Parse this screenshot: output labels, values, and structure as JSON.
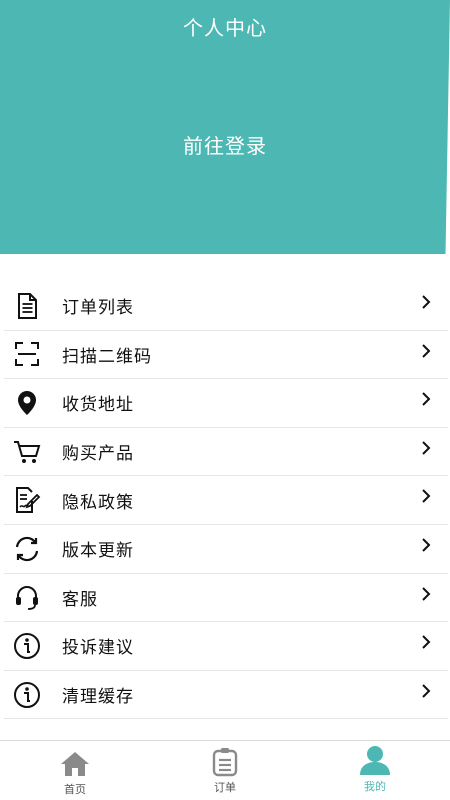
{
  "header": {
    "title": "个人中心",
    "login_label": "前往登录",
    "bg_color": "#4db8b3"
  },
  "menu": {
    "items": [
      {
        "label": "订单列表",
        "icon": "document-list-icon"
      },
      {
        "label": "扫描二维码",
        "icon": "scan-frame-icon"
      },
      {
        "label": "收货地址",
        "icon": "location-pin-icon"
      },
      {
        "label": "购买产品",
        "icon": "shopping-cart-icon"
      },
      {
        "label": "隐私政策",
        "icon": "policy-document-icon"
      },
      {
        "label": "版本更新",
        "icon": "refresh-icon"
      },
      {
        "label": "客服",
        "icon": "headset-icon"
      },
      {
        "label": "投诉建议",
        "icon": "info-icon"
      },
      {
        "label": "清理缓存",
        "icon": "info-icon"
      }
    ]
  },
  "tabbar": {
    "tabs": [
      {
        "label": "首页",
        "icon": "home-icon",
        "active": false
      },
      {
        "label": "订单",
        "icon": "order-list-icon",
        "active": false
      },
      {
        "label": "我的",
        "icon": "user-icon",
        "active": true
      }
    ],
    "active_color": "#4db8b3",
    "inactive_color": "#8a8a8a"
  }
}
